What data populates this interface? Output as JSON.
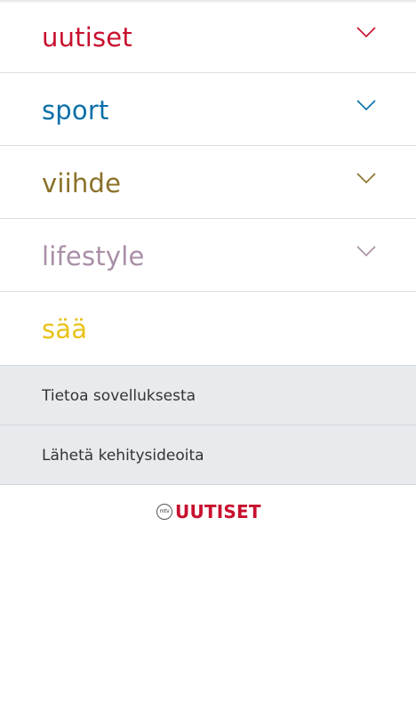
{
  "menu": {
    "items": [
      {
        "label": "uutiset",
        "color": "#c8102e",
        "expandable": true
      },
      {
        "label": "sport",
        "color": "#0a6fa8",
        "expandable": true
      },
      {
        "label": "viihde",
        "color": "#8a7028",
        "expandable": true
      },
      {
        "label": "lifestyle",
        "color": "#a98fa7",
        "expandable": true
      },
      {
        "label": "sää",
        "color": "#e8c21a",
        "expandable": false
      }
    ]
  },
  "footer": {
    "items": [
      {
        "label": "Tietoa sovelluksesta"
      },
      {
        "label": "Lähetä kehitysideoita"
      }
    ]
  },
  "logo": {
    "badge": "mtv",
    "wordmark": "UUTISET",
    "color": "#c8102e"
  }
}
